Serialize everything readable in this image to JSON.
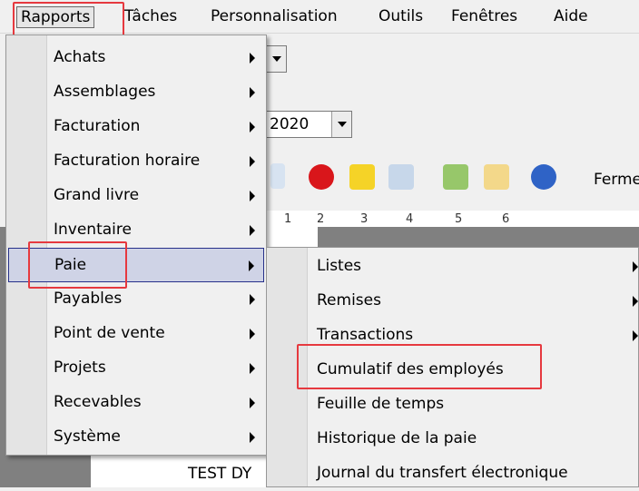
{
  "menubar": {
    "items": [
      {
        "label": "Rapports"
      },
      {
        "label": "Tâches"
      },
      {
        "label": "Personnalisation"
      },
      {
        "label": "Outils"
      },
      {
        "label": "Fenêtres"
      },
      {
        "label": "Aide"
      }
    ]
  },
  "background": {
    "year_combo_value": "2020",
    "toolbar_button_label": "Ferme",
    "ruler_ticks": [
      "1",
      "2",
      "3",
      "4",
      "5",
      "6"
    ],
    "doc_text": "TEST DY"
  },
  "reports_menu": {
    "items": [
      {
        "label": "Achats",
        "has_submenu": true
      },
      {
        "label": "Assemblages",
        "has_submenu": true
      },
      {
        "label": "Facturation",
        "has_submenu": true
      },
      {
        "label": "Facturation horaire",
        "has_submenu": true
      },
      {
        "label": "Grand livre",
        "has_submenu": true
      },
      {
        "label": "Inventaire",
        "has_submenu": true
      },
      {
        "label": "Paie",
        "has_submenu": true,
        "selected": true
      },
      {
        "label": "Payables",
        "has_submenu": true
      },
      {
        "label": "Point de vente",
        "has_submenu": true
      },
      {
        "label": "Projets",
        "has_submenu": true
      },
      {
        "label": "Recevables",
        "has_submenu": true
      },
      {
        "label": "Système",
        "has_submenu": true
      }
    ]
  },
  "payroll_submenu": {
    "items": [
      {
        "label": "Listes",
        "has_submenu": true
      },
      {
        "label": "Remises",
        "has_submenu": true
      },
      {
        "label": "Transactions",
        "has_submenu": true
      },
      {
        "label": "Cumulatif des employés",
        "has_submenu": false,
        "highlighted": true
      },
      {
        "label": "Feuille de temps",
        "has_submenu": false
      },
      {
        "label": "Historique de la paie",
        "has_submenu": false
      },
      {
        "label": "Journal du transfert électronique",
        "has_submenu": false
      }
    ]
  },
  "colors": {
    "highlight_box": "#e6393f",
    "selected_item_bg": "#cfd3e6",
    "selected_item_border": "#26308a"
  }
}
